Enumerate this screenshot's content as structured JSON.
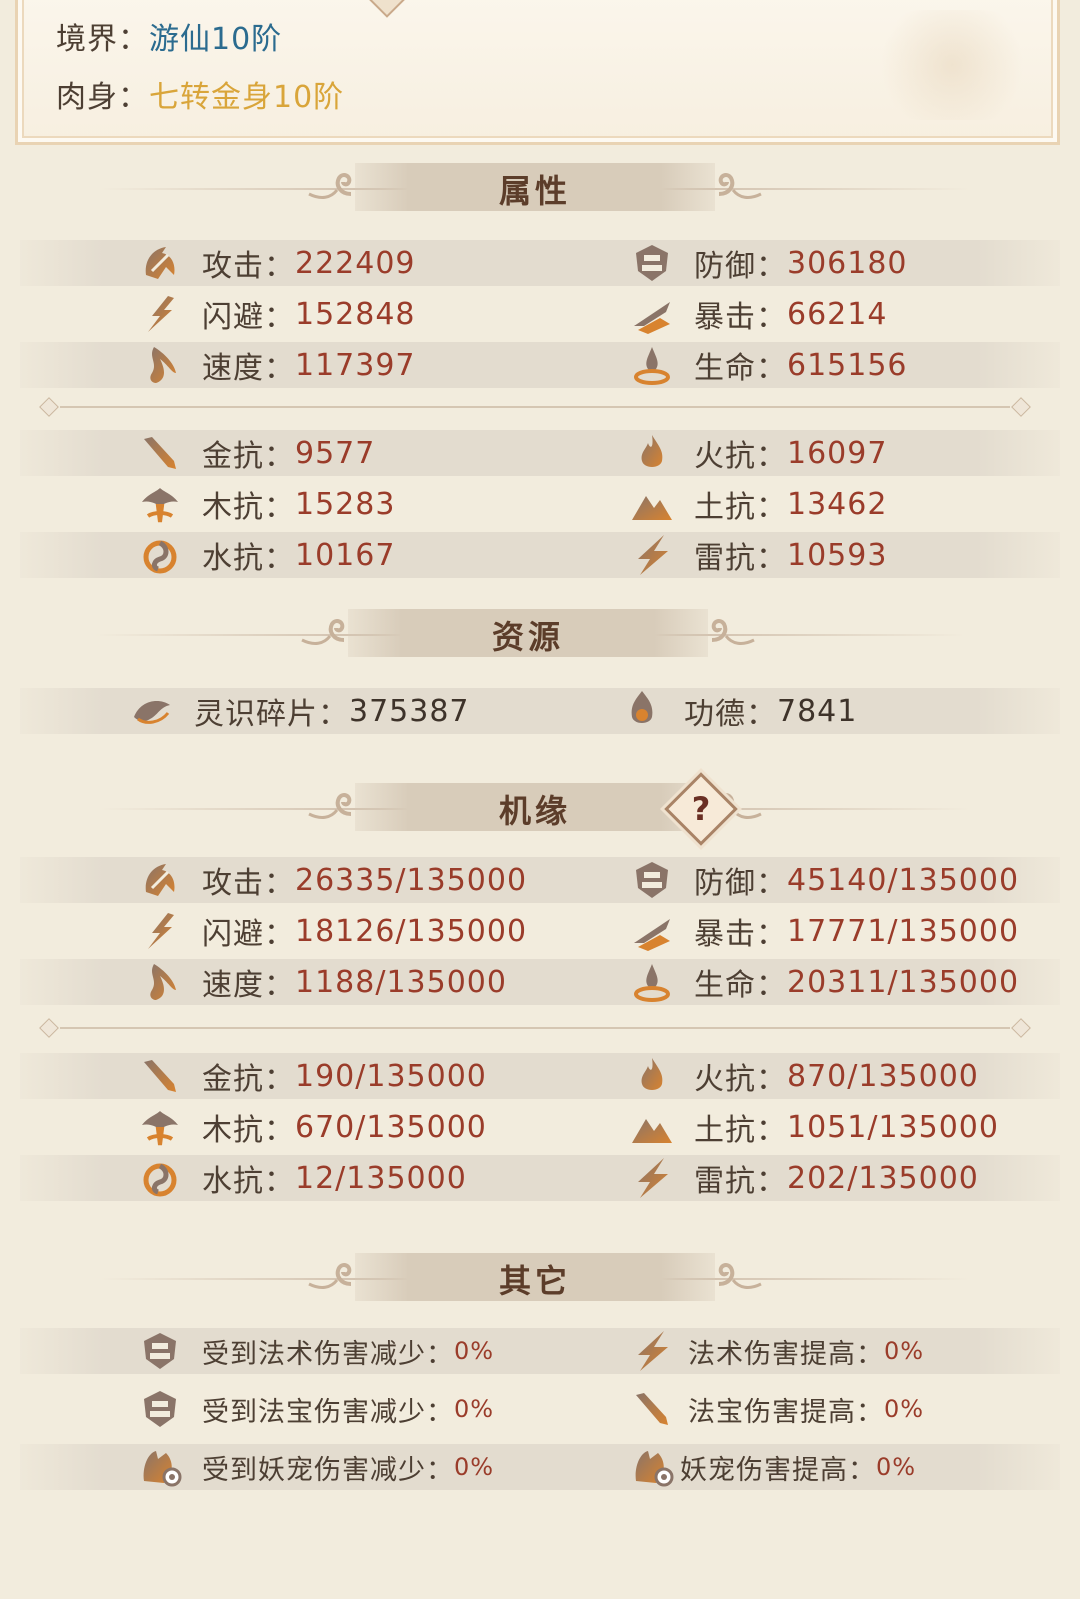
{
  "profile": {
    "realm_label": "境界：",
    "realm_value": "游仙10阶",
    "body_label": "肉身：",
    "body_value": "七转金身10阶"
  },
  "sections": {
    "attributes": "属性",
    "resources": "资源",
    "fortune": "机缘",
    "other": "其它"
  },
  "attributes": {
    "attack": {
      "label": "攻击：",
      "value": "222409",
      "icon": "attack-icon"
    },
    "defense": {
      "label": "防御：",
      "value": "306180",
      "icon": "defense-icon"
    },
    "dodge": {
      "label": "闪避：",
      "value": "152848",
      "icon": "dodge-icon"
    },
    "crit": {
      "label": "暴击：",
      "value": "66214",
      "icon": "crit-icon"
    },
    "speed": {
      "label": "速度：",
      "value": "117397",
      "icon": "speed-icon"
    },
    "hp": {
      "label": "生命：",
      "value": "615156",
      "icon": "life-icon"
    },
    "metal_res": {
      "label": "金抗：",
      "value": "9577",
      "icon": "metal-icon"
    },
    "fire_res": {
      "label": "火抗：",
      "value": "16097",
      "icon": "fire-icon"
    },
    "wood_res": {
      "label": "木抗：",
      "value": "15283",
      "icon": "wood-icon"
    },
    "earth_res": {
      "label": "土抗：",
      "value": "13462",
      "icon": "earth-icon"
    },
    "water_res": {
      "label": "水抗：",
      "value": "10167",
      "icon": "water-icon"
    },
    "thunder_res": {
      "label": "雷抗：",
      "value": "10593",
      "icon": "thunder-icon"
    }
  },
  "resources": {
    "fragments": {
      "label": "灵识碎片：",
      "value": "375387",
      "icon": "spirit-fragment-icon"
    },
    "merit": {
      "label": "功德：",
      "value": "7841",
      "icon": "merit-icon"
    }
  },
  "fortune": {
    "help_label": "?",
    "attack": {
      "label": "攻击：",
      "value": "26335/135000"
    },
    "defense": {
      "label": "防御：",
      "value": "45140/135000"
    },
    "dodge": {
      "label": "闪避：",
      "value": "18126/135000"
    },
    "crit": {
      "label": "暴击：",
      "value": "17771/135000"
    },
    "speed": {
      "label": "速度：",
      "value": "1188/135000"
    },
    "hp": {
      "label": "生命：",
      "value": "20311/135000"
    },
    "metal_res": {
      "label": "金抗：",
      "value": "190/135000"
    },
    "fire_res": {
      "label": "火抗：",
      "value": "870/135000"
    },
    "wood_res": {
      "label": "木抗：",
      "value": "670/135000"
    },
    "earth_res": {
      "label": "土抗：",
      "value": "1051/135000"
    },
    "water_res": {
      "label": "水抗：",
      "value": "12/135000"
    },
    "thunder_res": {
      "label": "雷抗：",
      "value": "202/135000"
    }
  },
  "other": {
    "spell_dmg_reduce": {
      "label": "受到法术伤害减少：",
      "value": "0%"
    },
    "spell_dmg_up": {
      "label": "法术伤害提高：",
      "value": "0%"
    },
    "artifact_dmg_reduce": {
      "label": "受到法宝伤害减少：",
      "value": "0%"
    },
    "artifact_dmg_up": {
      "label": "法宝伤害提高：",
      "value": "0%"
    },
    "pet_dmg_reduce": {
      "label": "受到妖宠伤害减少：",
      "value": "0%"
    },
    "pet_dmg_up": {
      "label": "妖宠伤害提高：",
      "value": "0%"
    }
  },
  "colors": {
    "value_red": "#9a3c2a",
    "realm_blue": "#2b6b8f",
    "body_gold": "#d9a53a",
    "background": "#f2ecdd"
  }
}
